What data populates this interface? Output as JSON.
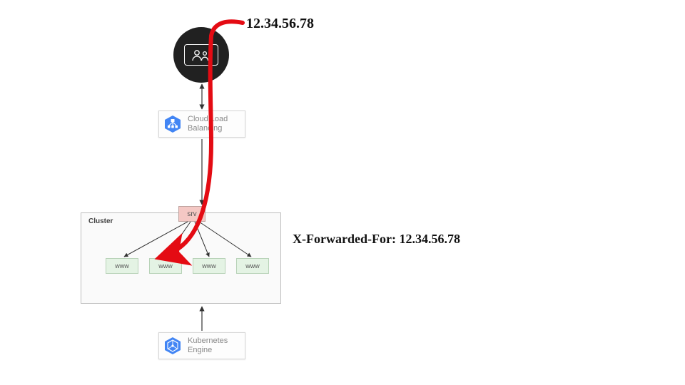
{
  "annotations": {
    "client_ip": "12.34.56.78",
    "xff_header": "X-Forwarded-For: 12.34.56.78"
  },
  "user": {
    "icon_name": "users-device-icon"
  },
  "load_balancer": {
    "label": "Cloud Load\nBalancing",
    "icon_name": "load-balancer-icon"
  },
  "cluster": {
    "label": "Cluster",
    "service": {
      "label": "srv"
    },
    "pods": [
      {
        "label": "www"
      },
      {
        "label": "www"
      },
      {
        "label": "www"
      },
      {
        "label": "www"
      }
    ]
  },
  "kubernetes": {
    "label": "Kubernetes\nEngine",
    "icon_name": "gke-icon"
  },
  "colors": {
    "flow_red": "#e40b13",
    "gcp_blue": "#4285F4",
    "svc_fill": "#f4c8c4",
    "pod_fill": "#e4f3e4"
  }
}
